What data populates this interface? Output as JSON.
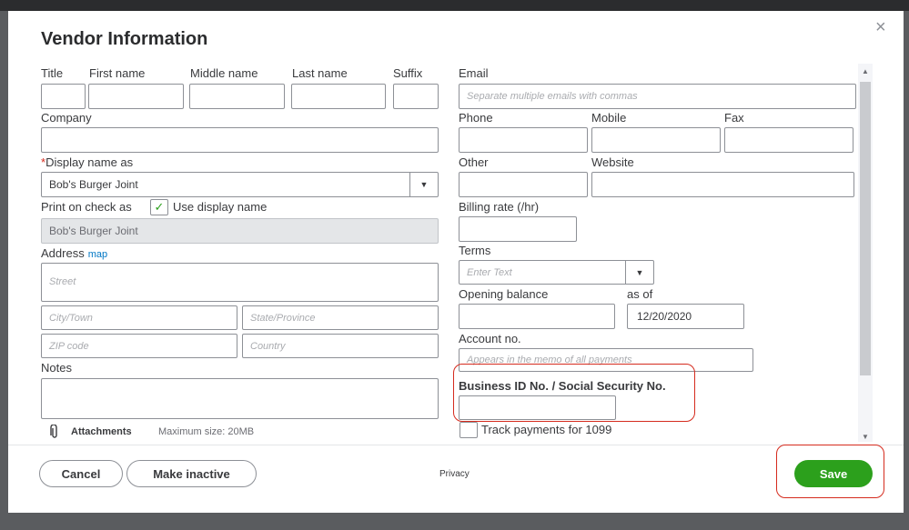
{
  "dialog": {
    "title": "Vendor Information",
    "close_glyph": "×"
  },
  "left": {
    "title_label": "Title",
    "first_name_label": "First name",
    "middle_name_label": "Middle name",
    "last_name_label": "Last name",
    "suffix_label": "Suffix",
    "company_label": "Company",
    "display_name_req": "*",
    "display_name_label": "Display name as",
    "display_name_value": "Bob's Burger Joint",
    "print_check_label": "Print on check as",
    "use_display_name_label": "Use display name",
    "print_check_value": "Bob's Burger Joint",
    "address_label": "Address",
    "map_link": "map",
    "street_placeholder": "Street",
    "city_placeholder": "City/Town",
    "state_placeholder": "State/Province",
    "zip_placeholder": "ZIP code",
    "country_placeholder": "Country",
    "notes_label": "Notes",
    "attachments_label": "Attachments",
    "attachments_max": "Maximum size: 20MB"
  },
  "right": {
    "email_label": "Email",
    "email_placeholder": "Separate multiple emails with commas",
    "phone_label": "Phone",
    "mobile_label": "Mobile",
    "fax_label": "Fax",
    "other_label": "Other",
    "website_label": "Website",
    "billing_rate_label": "Billing rate (/hr)",
    "terms_label": "Terms",
    "terms_placeholder": "Enter Text",
    "opening_balance_label": "Opening balance",
    "as_of_label": "as of",
    "as_of_value": "12/20/2020",
    "account_no_label": "Account no.",
    "account_no_placeholder": "Appears in the memo of all payments",
    "business_id_label": "Business ID No. / Social Security No.",
    "track_1099_label": "Track payments for 1099"
  },
  "footer": {
    "cancel_label": "Cancel",
    "make_inactive_label": "Make inactive",
    "privacy_label": "Privacy",
    "save_label": "Save"
  },
  "colors": {
    "accent": "#2ca01c",
    "highlight": "#d52b1e",
    "link": "#0077c5"
  }
}
